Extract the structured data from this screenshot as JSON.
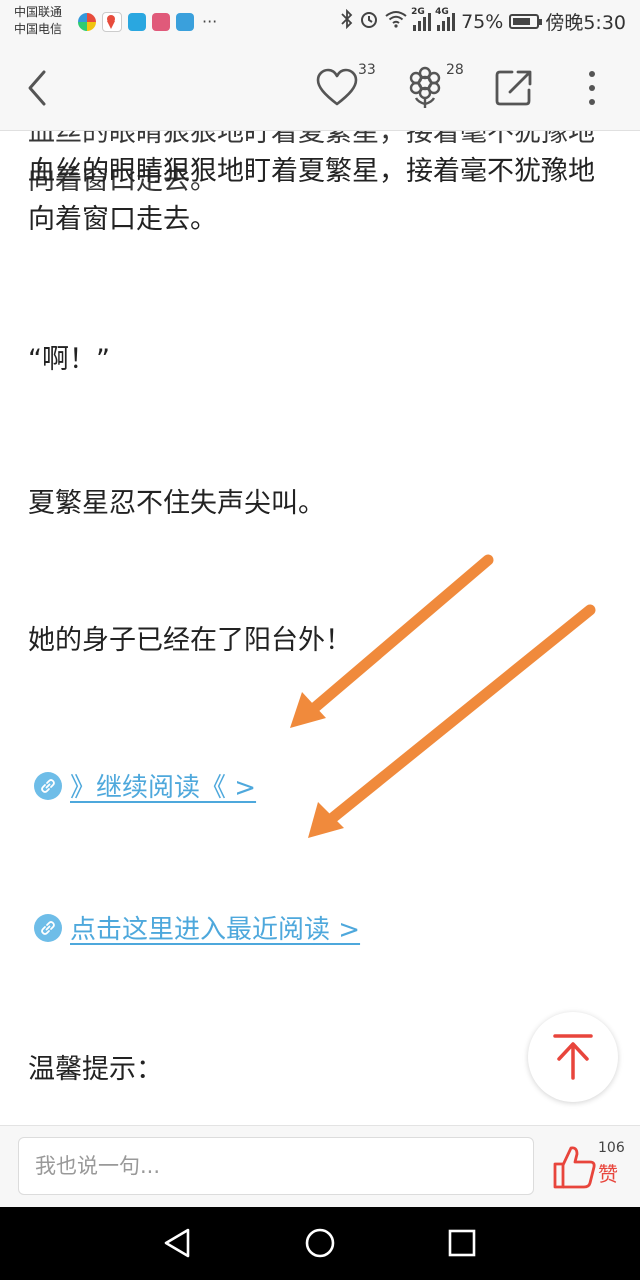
{
  "status_bar": {
    "carrier_1": "中国联通",
    "carrier_2": "中国电信",
    "more_notifications": "···",
    "network_1": "2G",
    "network_2": "4G",
    "battery_percent": "75%",
    "battery_level": 0.75,
    "time": "傍晚5:30"
  },
  "toolbar": {
    "like_count": "33",
    "gift_count": "28",
    "icons": [
      "back-icon",
      "heart-icon",
      "flower-icon",
      "share-icon",
      "more-icon"
    ]
  },
  "article": {
    "line_partial": "血丝的眼睛狠狠地盯着夏繁星，接着毫不犹豫地向着窗口走去。",
    "para_1": "血丝的眼睛狠狠地盯着夏繁星，接着毫不犹豫地向着窗口走去。",
    "para_2": "“啊！”",
    "para_3": "夏繁星忍不住失声尖叫。",
    "para_4": "她的身子已经在了阳台外！",
    "link_1": "》继续阅读《 >",
    "link_2": "点击这里进入最近阅读 >",
    "para_5": "温馨提示："
  },
  "bottom_bar": {
    "comment_placeholder": "我也说一句...",
    "like_count": "106",
    "like_label": "赞"
  },
  "colors": {
    "link": "#4ea8dc",
    "link_icon_bg": "#6ebde8",
    "accent_red": "#e8453c",
    "annotation_arrow": "#f08a3c"
  }
}
